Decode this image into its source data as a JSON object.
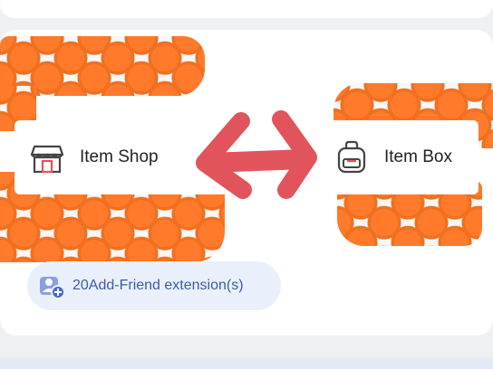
{
  "colors": {
    "arrow": "#e2545c",
    "chip_text": "#3e5ca8",
    "chip_bg": "#e9f0fb",
    "orange": "#ff7a2a",
    "leaf": "#1f7a2e"
  },
  "menu": {
    "items": [
      {
        "label": "Item Shop",
        "icon": "shop-icon"
      },
      {
        "label": "Item Box",
        "icon": "backpack-icon"
      }
    ]
  },
  "extension": {
    "count": "20",
    "label": "Add-Friend extension(s)",
    "icon": "add-friend-icon"
  },
  "annotation": {
    "icon": "double-arrow-icon"
  }
}
